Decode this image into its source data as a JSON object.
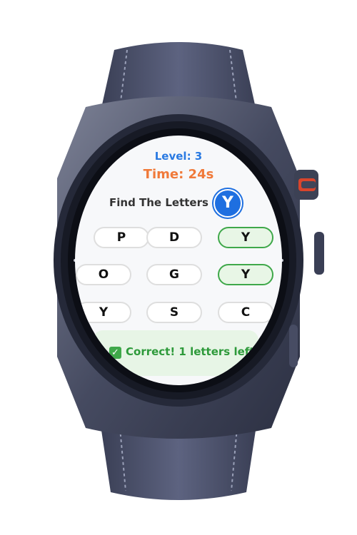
{
  "game": {
    "level_text": "Level: 3",
    "time_text": "Time: 24s",
    "prompt": "Find The Letters",
    "target_letter": "Y",
    "grid": [
      {
        "letter": "P",
        "found": false
      },
      {
        "letter": "D",
        "found": false
      },
      {
        "letter": "Y",
        "found": true
      },
      {
        "letter": "O",
        "found": false
      },
      {
        "letter": "G",
        "found": false
      },
      {
        "letter": "Y",
        "found": true
      },
      {
        "letter": "Y",
        "found": false
      },
      {
        "letter": "S",
        "found": false
      },
      {
        "letter": "C",
        "found": false
      }
    ],
    "status_icon": "check-icon",
    "status_text": "Correct! 1 letters left",
    "colors": {
      "level": "#2a7ae2",
      "time": "#f07a3a",
      "target_bg": "#1e6fe0",
      "found_border": "#3fa84a",
      "status_bg": "#e7f5e6",
      "status_text": "#2e9a3b"
    }
  }
}
